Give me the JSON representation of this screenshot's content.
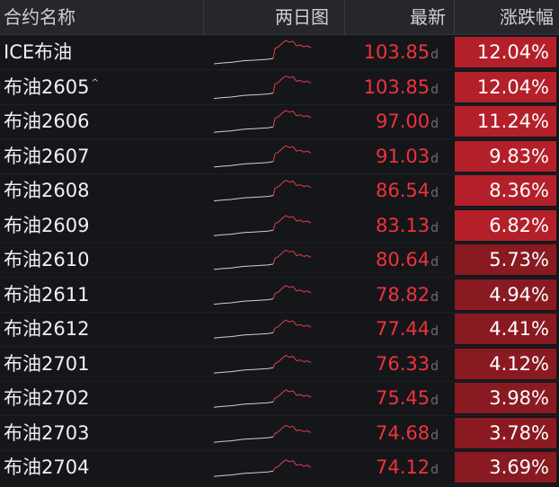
{
  "header": {
    "name_label": "合约名称",
    "chart_label": "两日图",
    "price_label": "最新",
    "change_label": "涨跌幅"
  },
  "colors": {
    "up": "#f0323c",
    "badge_strong": "#b4202a",
    "badge_medium": "#8a1a22",
    "background": "#15161a"
  },
  "rows": [
    {
      "name": "ICE布油",
      "mark": "",
      "price": "103.85",
      "flag": "d",
      "change": "12.04%",
      "change_value": 12.04
    },
    {
      "name": "布油2605",
      "mark": "^",
      "price": "103.85",
      "flag": "d",
      "change": "12.04%",
      "change_value": 12.04
    },
    {
      "name": "布油2606",
      "mark": "",
      "price": "97.00",
      "flag": "d",
      "change": "11.24%",
      "change_value": 11.24
    },
    {
      "name": "布油2607",
      "mark": "",
      "price": "91.03",
      "flag": "d",
      "change": "9.83%",
      "change_value": 9.83
    },
    {
      "name": "布油2608",
      "mark": "",
      "price": "86.54",
      "flag": "d",
      "change": "8.36%",
      "change_value": 8.36
    },
    {
      "name": "布油2609",
      "mark": "",
      "price": "83.13",
      "flag": "d",
      "change": "6.82%",
      "change_value": 6.82
    },
    {
      "name": "布油2610",
      "mark": "",
      "price": "80.64",
      "flag": "d",
      "change": "5.73%",
      "change_value": 5.73
    },
    {
      "name": "布油2611",
      "mark": "",
      "price": "78.82",
      "flag": "d",
      "change": "4.94%",
      "change_value": 4.94
    },
    {
      "name": "布油2612",
      "mark": "",
      "price": "77.44",
      "flag": "d",
      "change": "4.41%",
      "change_value": 4.41
    },
    {
      "name": "布油2701",
      "mark": "",
      "price": "76.33",
      "flag": "d",
      "change": "4.12%",
      "change_value": 4.12
    },
    {
      "name": "布油2702",
      "mark": "",
      "price": "75.45",
      "flag": "d",
      "change": "3.98%",
      "change_value": 3.98
    },
    {
      "name": "布油2703",
      "mark": "",
      "price": "74.68",
      "flag": "d",
      "change": "3.78%",
      "change_value": 3.78
    },
    {
      "name": "布油2704",
      "mark": "",
      "price": "74.12",
      "flag": "d",
      "change": "3.69%",
      "change_value": 3.69
    }
  ]
}
